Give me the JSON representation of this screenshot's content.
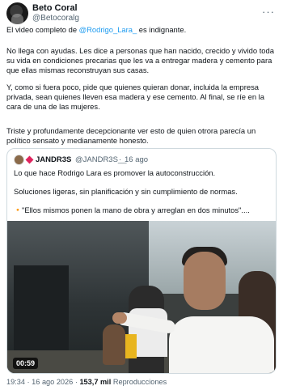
{
  "tweet": {
    "author_name": "Beto Coral",
    "author_handle": "@Betocoralg",
    "more_label": "···",
    "p1_before": "El video completo de ",
    "p1_mention": "@Rodrigo_Lara_",
    "p1_after": " es indignante.",
    "p2": "No llega con ayudas. Les dice a personas que han nacido, crecido y vivido toda su vida en condiciones precarias que les va a entregar madera y cemento para que ellas mismas reconstruyan sus casas.",
    "p3": "Y, como si fuera poco, pide que quienes quieran donar, incluida la empresa privada, sean quienes lleven esa madera y ese cemento. Al final, se ríe en la cara de una de las mujeres.",
    "p4": "Triste y profundamente decepcionante ver esto de quien otrora parecía un político sensato y medianamente honesto."
  },
  "quoted": {
    "author_name": "JANDR3S",
    "author_handle": "@JANDR3S__",
    "separator": "·",
    "time": "16 ago",
    "p1": "Lo que hace Rodrigo Lara es promover la autoconstrucción.",
    "p2": "Soluciones ligeras, sin planificación y sin cumplimiento de normas.",
    "p3_icon": "🔸",
    "p3": "\"Ellos mismos ponen la mano de obra y arreglan en dos minutos\"....",
    "video_duration": "00:59"
  },
  "footer": {
    "time": "19:34",
    "date_sep": " · ",
    "date": "16 ago 2026",
    "views_sep": " · ",
    "views_count": "153,7 mil",
    "views_label": " Reproducciones"
  },
  "colors": {
    "accent": "#1d9bf0",
    "text": "#0f1419",
    "muted": "#536471",
    "border": "#cfd9de"
  },
  "icons": [
    "avatar",
    "more-icon",
    "diamond-icon",
    "orange-diamond-icon",
    "video-thumbnail"
  ]
}
